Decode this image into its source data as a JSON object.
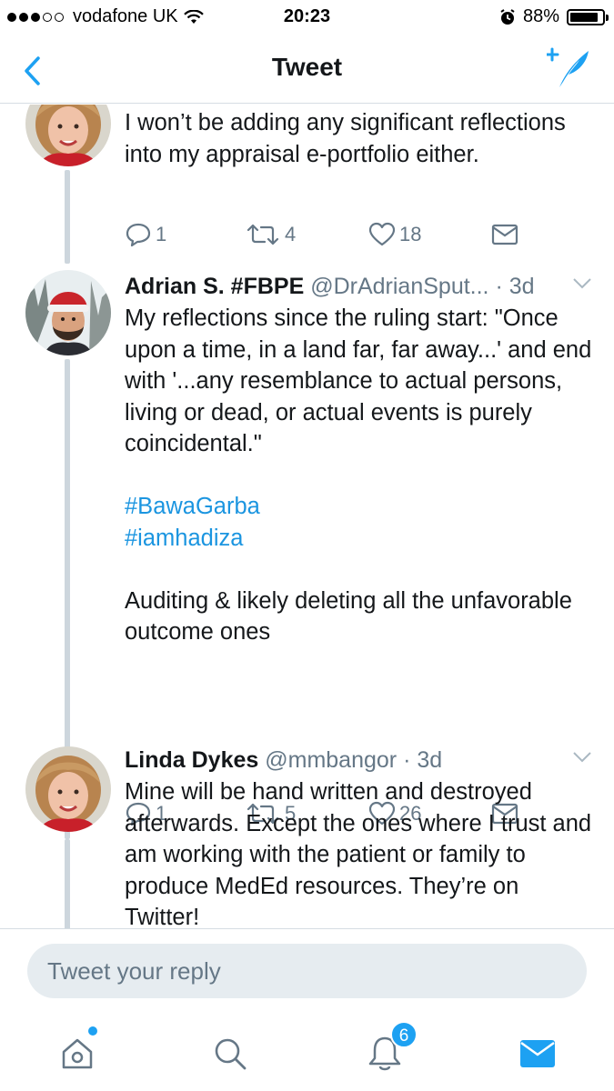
{
  "status_bar": {
    "carrier": "vodafone UK",
    "time": "20:23",
    "battery_percent": "88%",
    "battery_level": 0.88,
    "signal_bars_filled": 3,
    "signal_bars_total": 5
  },
  "nav": {
    "title": "Tweet",
    "back_icon": "chevron-left-icon",
    "compose_icon": "compose-tweet-icon"
  },
  "tweets": [
    {
      "name": "",
      "handle": "",
      "time": "",
      "paragraphs": [
        "I won’t be adding any significant reflections into my appraisal e-portfolio either."
      ],
      "hashtags": [],
      "replies": "1",
      "retweets": "4",
      "likes": "18"
    },
    {
      "name": "Adrian S. #FBPE",
      "handle": "@DrAdrianSput...",
      "time": "· 3d",
      "paragraphs": [
        "My reflections since the ruling start: \"Once upon a time, in a land far, far away...' and end with '...any resemblance to actual persons, living or dead, or actual events is purely coincidental.\"",
        "Auditing & likely deleting all the unfavorable outcome ones"
      ],
      "hashtags": [
        "#BawaGarba",
        "#iamhadiza"
      ],
      "replies": "1",
      "retweets": "5",
      "likes": "26"
    },
    {
      "name": "Linda Dykes",
      "handle": "@mmbangor",
      "time": "· 3d",
      "paragraphs": [
        "Mine will be hand written and destroyed afterwards. Except the ones where I trust and am working with the patient or family to produce MedEd resources. They’re on Twitter!"
      ],
      "hashtags": []
    }
  ],
  "reply": {
    "placeholder": "Tweet your reply"
  },
  "tab_bar": {
    "notifications_badge": "6",
    "active_tab": "messages",
    "colors": {
      "active": "#1da1f2",
      "inactive": "#657786"
    }
  },
  "colors": {
    "accent": "#1da1f2",
    "hashtag": "#1b95e0",
    "muted": "#657786",
    "thread_line": "#cdd6dd"
  }
}
